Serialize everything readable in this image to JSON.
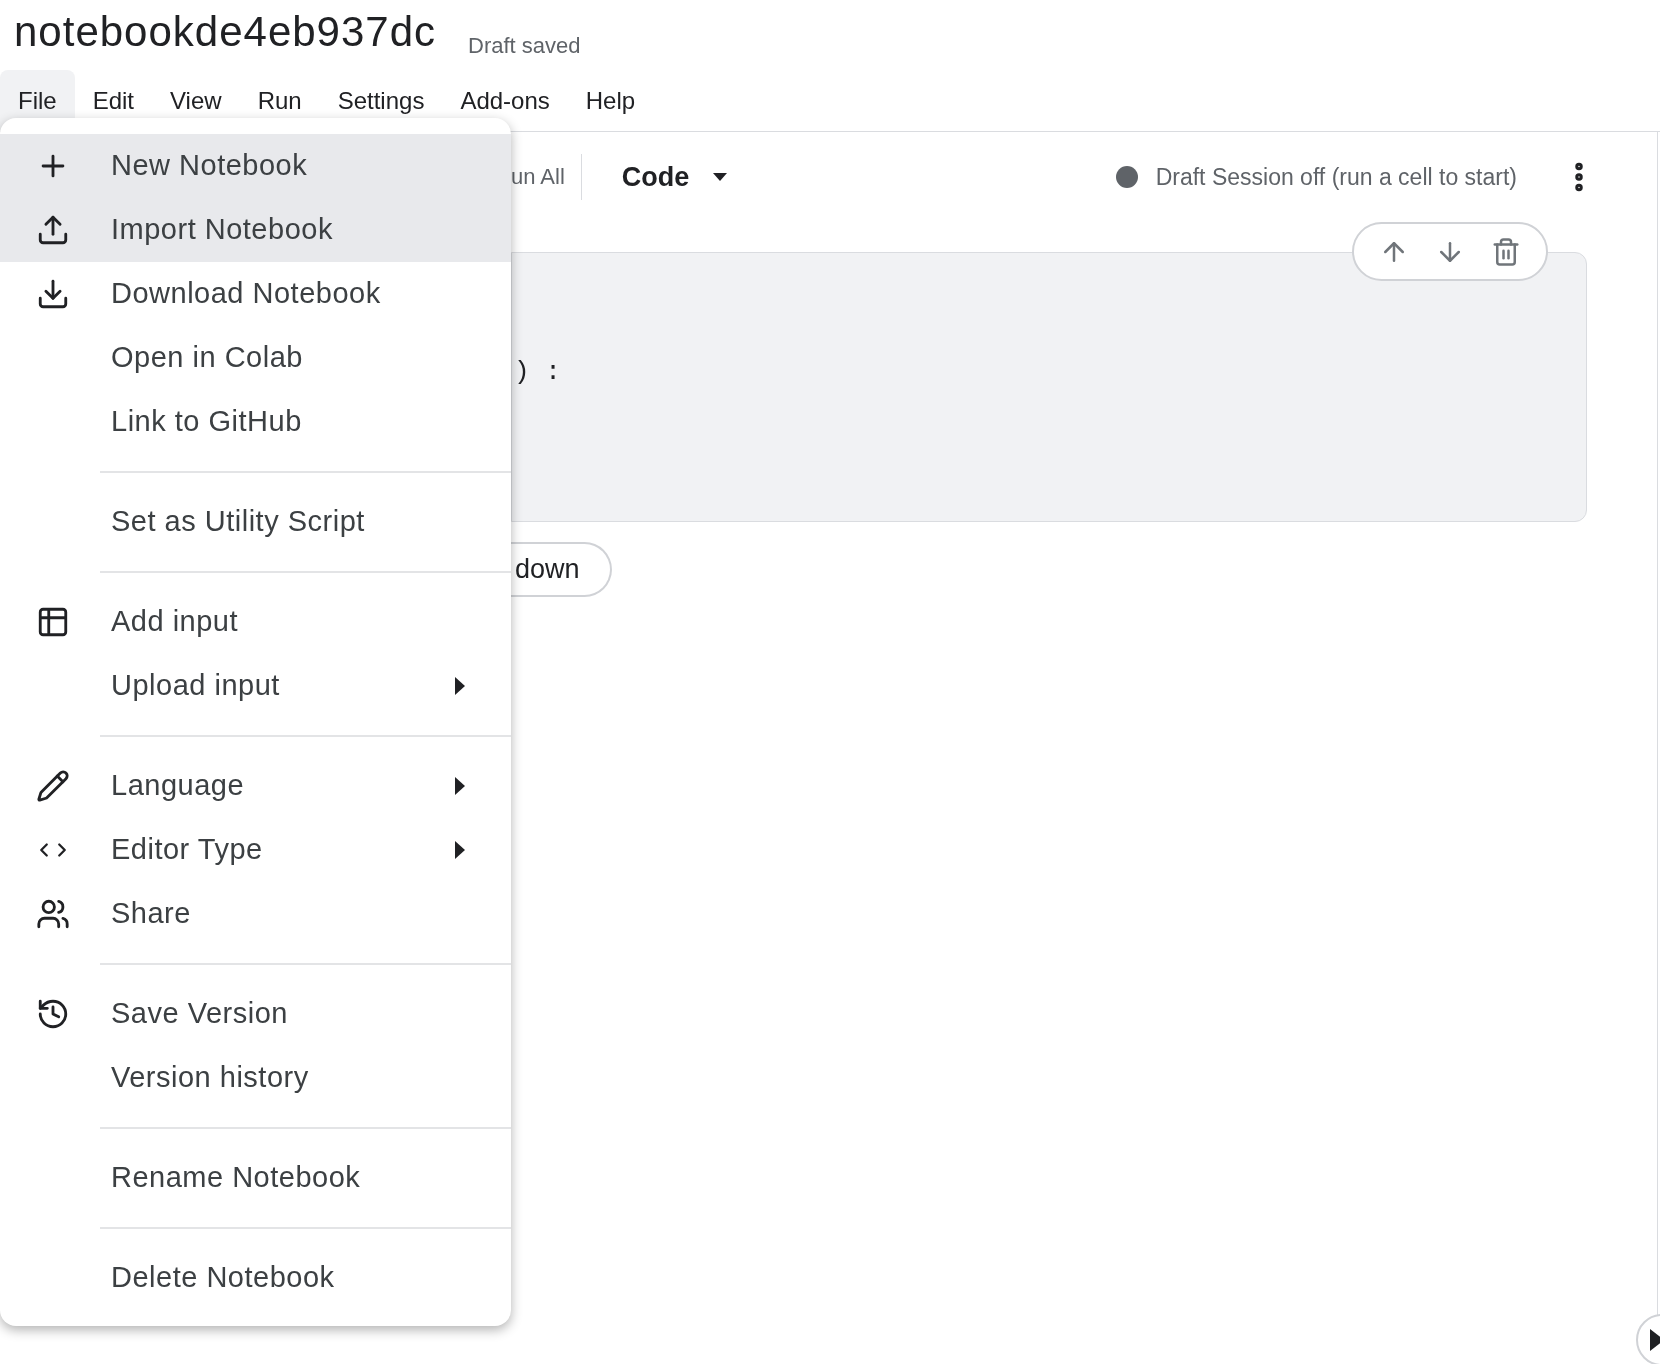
{
  "notebook": {
    "title": "notebookde4eb937dc",
    "save_status": "Draft saved"
  },
  "menubar": [
    {
      "label": "File",
      "selected": true
    },
    {
      "label": "Edit",
      "selected": false
    },
    {
      "label": "View",
      "selected": false
    },
    {
      "label": "Run",
      "selected": false
    },
    {
      "label": "Settings",
      "selected": false
    },
    {
      "label": "Add-ons",
      "selected": false
    },
    {
      "label": "Help",
      "selected": false
    }
  ],
  "toolbar": {
    "run_all": "un All",
    "cell_type": "Code",
    "session_status": "Draft Session off (run a cell to start)"
  },
  "cell": {
    "code_fragment": ") :"
  },
  "add_cell_button": "down",
  "file_menu": {
    "sections": [
      {
        "items": [
          {
            "label": "New Notebook",
            "highlighted": true,
            "submenu": false
          },
          {
            "label": "Import Notebook",
            "highlighted": true,
            "submenu": false
          },
          {
            "label": "Download Notebook",
            "highlighted": false,
            "submenu": false
          },
          {
            "label": "Open in Colab",
            "highlighted": false,
            "submenu": false
          },
          {
            "label": "Link to GitHub",
            "highlighted": false,
            "submenu": false
          }
        ]
      },
      {
        "items": [
          {
            "label": "Set as Utility Script",
            "highlighted": false,
            "submenu": false
          }
        ]
      },
      {
        "items": [
          {
            "label": "Add input",
            "highlighted": false,
            "submenu": false
          },
          {
            "label": "Upload input",
            "highlighted": false,
            "submenu": true
          }
        ]
      },
      {
        "items": [
          {
            "label": "Language",
            "highlighted": false,
            "submenu": true
          },
          {
            "label": "Editor Type",
            "highlighted": false,
            "submenu": true
          },
          {
            "label": "Share",
            "highlighted": false,
            "submenu": false
          }
        ]
      },
      {
        "items": [
          {
            "label": "Save Version",
            "highlighted": false,
            "submenu": false
          },
          {
            "label": "Version history",
            "highlighted": false,
            "submenu": false
          }
        ]
      },
      {
        "items": [
          {
            "label": "Rename Notebook",
            "highlighted": false,
            "submenu": false
          }
        ]
      },
      {
        "items": [
          {
            "label": "Delete Notebook",
            "highlighted": false,
            "submenu": false
          }
        ]
      }
    ]
  }
}
